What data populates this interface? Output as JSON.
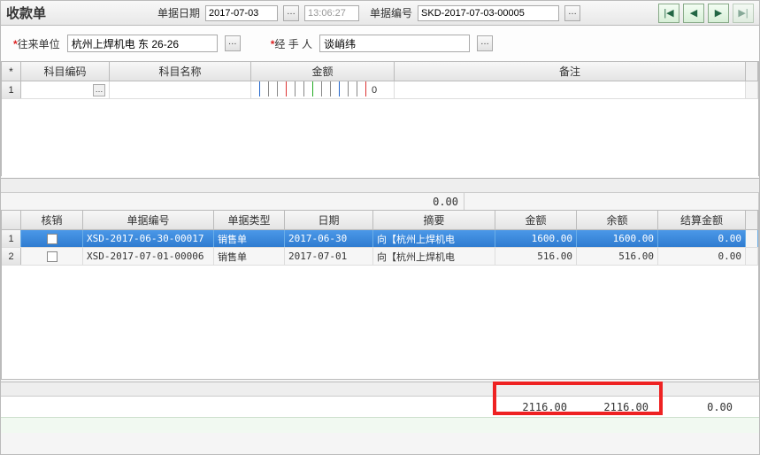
{
  "header": {
    "title": "收款单",
    "bill_date_label": "单据日期",
    "bill_date": "2017-07-03",
    "bill_time": "13:06:27",
    "bill_no_label": "单据编号",
    "bill_no": "SKD-2017-07-03-00005"
  },
  "form": {
    "partner_label": "往来单位",
    "partner": "杭州上焊机电 东 26-26",
    "handler_label": "经 手 人",
    "handler": "谈峭纬"
  },
  "grid1": {
    "cols": {
      "idx": "*",
      "code": "科目编码",
      "name": "科目名称",
      "amount": "金额",
      "remark": "备注"
    },
    "rows": [
      {
        "n": "1",
        "code": "",
        "name": "",
        "amount_display": "0",
        "remark": ""
      }
    ],
    "total": "0.00"
  },
  "grid2": {
    "cols": {
      "hx": "核销",
      "no": "单据编号",
      "type": "单据类型",
      "date": "日期",
      "summary": "摘要",
      "amount": "金额",
      "balance": "余额",
      "settle": "结算金额"
    },
    "rows": [
      {
        "n": "1",
        "selected": true,
        "hx": false,
        "no": "XSD-2017-06-30-00017",
        "type": "销售单",
        "date": "2017-06-30",
        "summary": "向【杭州上焊机电",
        "amount": "1600.00",
        "balance": "1600.00",
        "settle": "0.00"
      },
      {
        "n": "2",
        "selected": false,
        "hx": false,
        "no": "XSD-2017-07-01-00006",
        "type": "销售单",
        "date": "2017-07-01",
        "summary": "向【杭州上焊机电",
        "amount": "516.00",
        "balance": "516.00",
        "settle": "0.00"
      }
    ],
    "sum_amount": "2116.00",
    "sum_balance": "2116.00",
    "sum_settle": "0.00"
  }
}
